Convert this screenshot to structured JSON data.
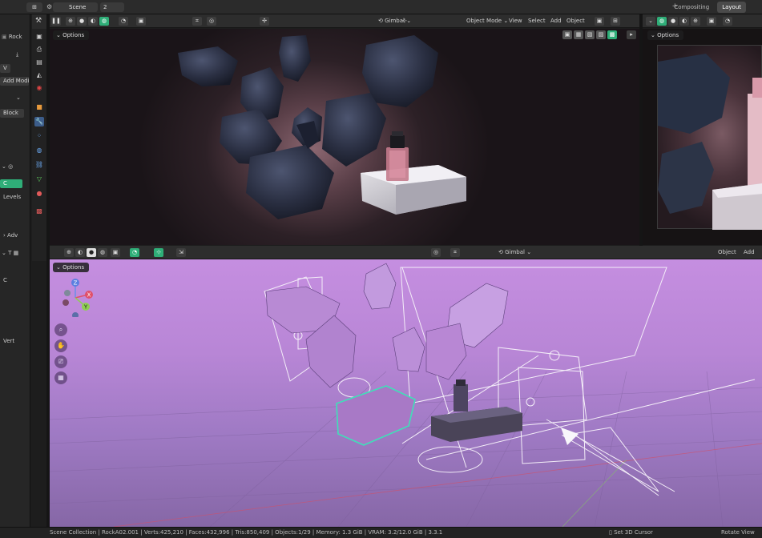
{
  "topbar": {
    "scene_label": "Scene",
    "small_value": "2",
    "tabs": [
      "Layout",
      "Compositing"
    ]
  },
  "left_panel": {
    "rock_label": "Rock",
    "add_modifier": "Add Modi",
    "blocks": "Block",
    "levels": "Levels",
    "adv": "Adv",
    "verts": "Vert",
    "chip_green": "C"
  },
  "render_header": {
    "gimbal": "Gimbal",
    "menus": [
      "Object Mode",
      "View",
      "Select",
      "Add",
      "Object"
    ],
    "options": "Options"
  },
  "side_header": {
    "options": "Options"
  },
  "solid_header": {
    "gimbal": "Gimbal",
    "menus": [
      "Add",
      "Object"
    ],
    "options": "Options"
  },
  "gizmo": {
    "x_label": "X",
    "y_label": "Y",
    "z_label": "Z"
  },
  "statusbar": {
    "info": "Scene Collection | RockA02.001 | Verts:425,210 | Faces:432,996 | Tris:850,409 | Objects:1/29 | Memory: 1.3 GiB | VRAM: 3.2/12.0 GiB | 3.3.1",
    "set_cursor": "Set 3D Cursor",
    "rotate_view": "Rotate View"
  },
  "colors": {
    "accent_green": "#2fae78",
    "viewport_pink": "#c58ee0",
    "selection_teal": "#3fe0b8"
  }
}
